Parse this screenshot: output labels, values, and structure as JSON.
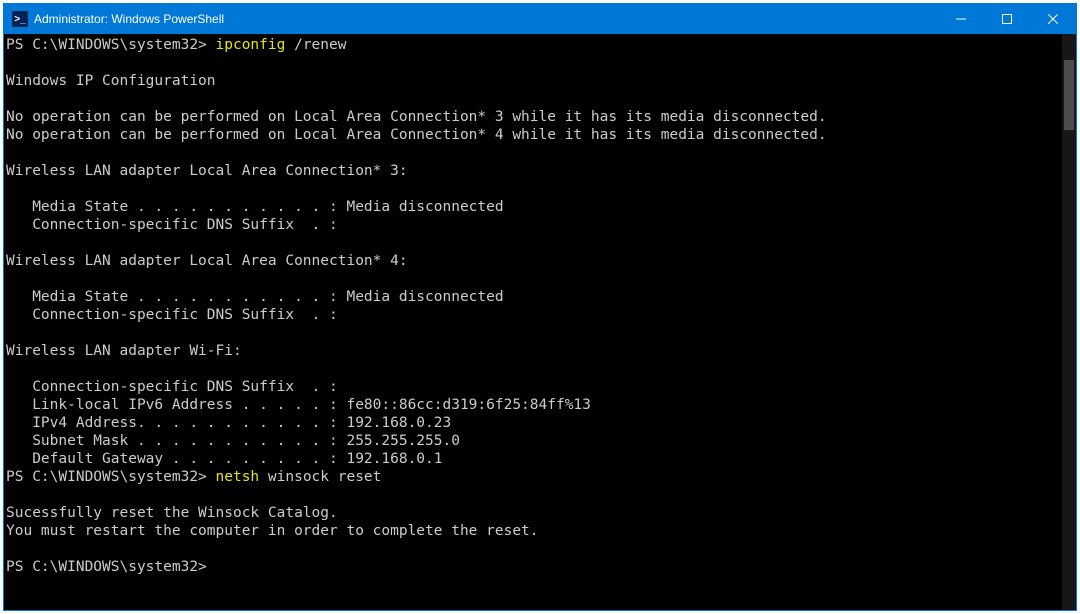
{
  "titlebar": {
    "icon_glyph": ">_",
    "title": "Administrator: Windows PowerShell"
  },
  "prompt1": {
    "path": "PS C:\\WINDOWS\\system32> ",
    "cmd_first": "ipconfig",
    "cmd_rest": " /renew"
  },
  "out": {
    "l1": "Windows IP Configuration",
    "l2": "No operation can be performed on Local Area Connection* 3 while it has its media disconnected.",
    "l3": "No operation can be performed on Local Area Connection* 4 while it has its media disconnected.",
    "a3_header": "Wireless LAN adapter Local Area Connection* 3:",
    "a3_media": "   Media State . . . . . . . . . . . : Media disconnected",
    "a3_dns": "   Connection-specific DNS Suffix  . :",
    "a4_header": "Wireless LAN adapter Local Area Connection* 4:",
    "a4_media": "   Media State . . . . . . . . . . . : Media disconnected",
    "a4_dns": "   Connection-specific DNS Suffix  . :",
    "wifi_header": "Wireless LAN adapter Wi-Fi:",
    "wifi_dns": "   Connection-specific DNS Suffix  . :",
    "wifi_ll6": "   Link-local IPv6 Address . . . . . : fe80::86cc:d319:6f25:84ff%13",
    "wifi_ipv4": "   IPv4 Address. . . . . . . . . . . : 192.168.0.23",
    "wifi_mask": "   Subnet Mask . . . . . . . . . . . : 255.255.255.0",
    "wifi_gw": "   Default Gateway . . . . . . . . . : 192.168.0.1"
  },
  "prompt2": {
    "path": "PS C:\\WINDOWS\\system32> ",
    "cmd_first": "netsh",
    "cmd_rest": " winsock reset"
  },
  "out2": {
    "l1": "Sucessfully reset the Winsock Catalog.",
    "l2": "You must restart the computer in order to complete the reset."
  },
  "prompt3": {
    "path": "PS C:\\WINDOWS\\system32>"
  }
}
